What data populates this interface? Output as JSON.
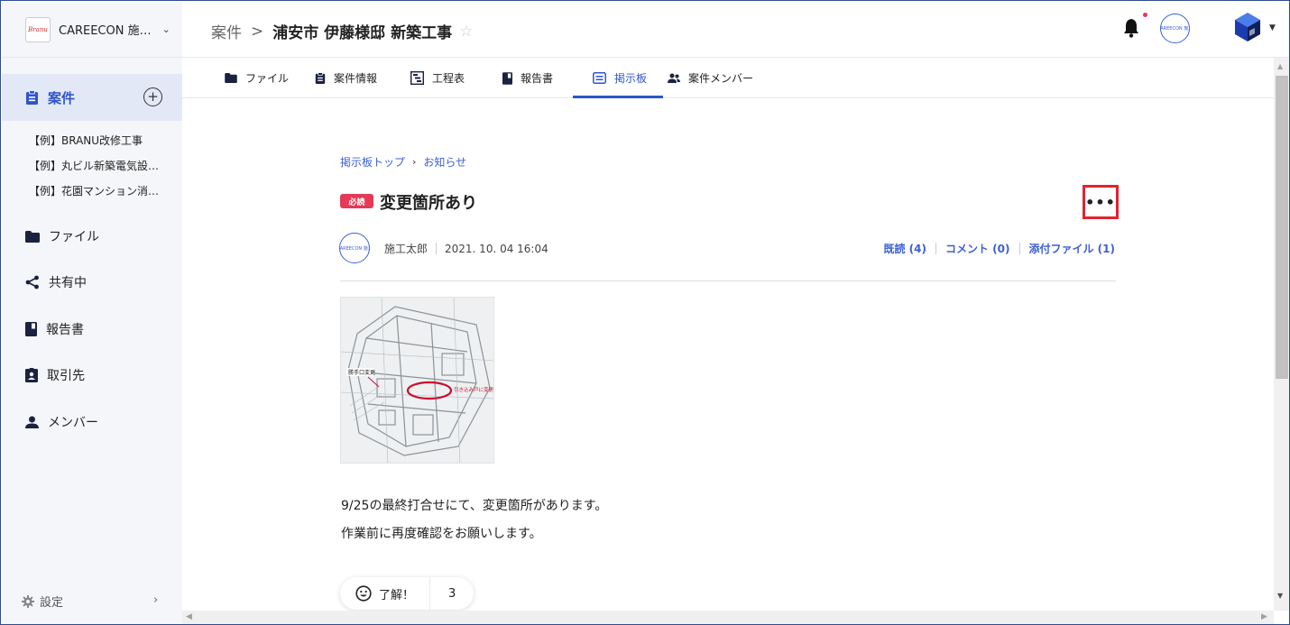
{
  "app": {
    "brand_logo_text": "Branu",
    "company_name": "CAREECON 施…",
    "accent_color": "#2f56c8",
    "alert_color": "#e53955"
  },
  "header": {
    "breadcrumb_parent": "案件",
    "breadcrumb_separator": ">",
    "project_title": "浦安市 伊藤様邸 新築工事",
    "favorite_icon": "star-outline-icon",
    "avatar_text": "CAREECON 施工"
  },
  "sidebar": {
    "projects_label": "案件",
    "projects": [
      "【例】BRANU改修工事",
      "【例】丸ビル新築電気設…",
      "【例】花園マンション消…"
    ],
    "nav": [
      {
        "label": "ファイル",
        "icon": "folder-icon"
      },
      {
        "label": "共有中",
        "icon": "share-icon"
      },
      {
        "label": "報告書",
        "icon": "book-icon"
      },
      {
        "label": "取引先",
        "icon": "contact-badge-icon"
      },
      {
        "label": "メンバー",
        "icon": "person-icon"
      }
    ],
    "settings_label": "設定"
  },
  "tabs": [
    {
      "label": "ファイル",
      "icon": "folder-icon",
      "active": false
    },
    {
      "label": "案件情報",
      "icon": "clipboard-icon",
      "active": false
    },
    {
      "label": "工程表",
      "icon": "gantt-icon",
      "active": false
    },
    {
      "label": "報告書",
      "icon": "book-icon",
      "active": false
    },
    {
      "label": "掲示板",
      "icon": "message-board-icon",
      "active": true
    },
    {
      "label": "案件メンバー",
      "icon": "people-icon",
      "active": false
    }
  ],
  "post": {
    "crumb_top": "掲示板トップ",
    "crumb_current": "お知らせ",
    "required_badge": "必読",
    "title": "変更箇所あり",
    "more_label": "•••",
    "author_avatar_text": "CAREECON 施工",
    "author": "施工太郎",
    "datetime": "2021. 10. 04 16:04",
    "read_label": "既読 (4)",
    "comment_label": "コメント (0)",
    "attachment_label": "添付ファイル (1)",
    "image_annotations": {
      "left_label": "勝手口変更",
      "right_label": "引き込み戸に変更"
    },
    "body_lines": [
      "9/25の最終打合せにて、変更箇所があります。",
      "作業前に再度確認をお願いします。"
    ],
    "reaction_label": "了解！",
    "reaction_count": "3"
  }
}
